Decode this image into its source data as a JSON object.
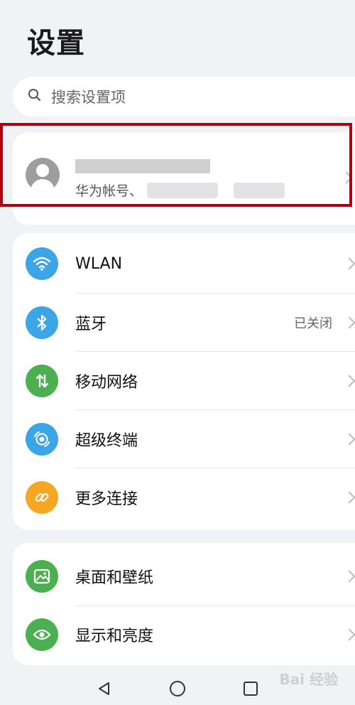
{
  "header": {
    "title": "设置"
  },
  "search": {
    "placeholder": "搜索设置项",
    "icon": "search-icon"
  },
  "account": {
    "subtitle": "华为帐号、",
    "avatar_icon": "person-icon"
  },
  "connectivity": [
    {
      "id": "wlan",
      "label": "WLAN",
      "value": "",
      "icon": "wifi-icon",
      "color": "#3ba5e8"
    },
    {
      "id": "bluetooth",
      "label": "蓝牙",
      "value": "已关闭",
      "icon": "bluetooth-icon",
      "color": "#3ba5e8"
    },
    {
      "id": "mobile",
      "label": "移动网络",
      "value": "",
      "icon": "mobile-network-icon",
      "color": "#4caf50"
    },
    {
      "id": "super",
      "label": "超级终端",
      "value": "",
      "icon": "super-device-icon",
      "color": "#3ba5e8"
    },
    {
      "id": "more",
      "label": "更多连接",
      "value": "",
      "icon": "link-icon",
      "color": "#f5a623"
    }
  ],
  "display": [
    {
      "id": "wallpaper",
      "label": "桌面和壁纸",
      "icon": "picture-icon",
      "color": "#4caf50"
    },
    {
      "id": "brightness",
      "label": "显示和亮度",
      "icon": "eye-icon",
      "color": "#4caf50"
    }
  ],
  "navbar": {
    "back": "back-icon",
    "home": "home-icon",
    "recents": "recents-icon"
  },
  "watermark": {
    "text": "Bai 经验"
  }
}
